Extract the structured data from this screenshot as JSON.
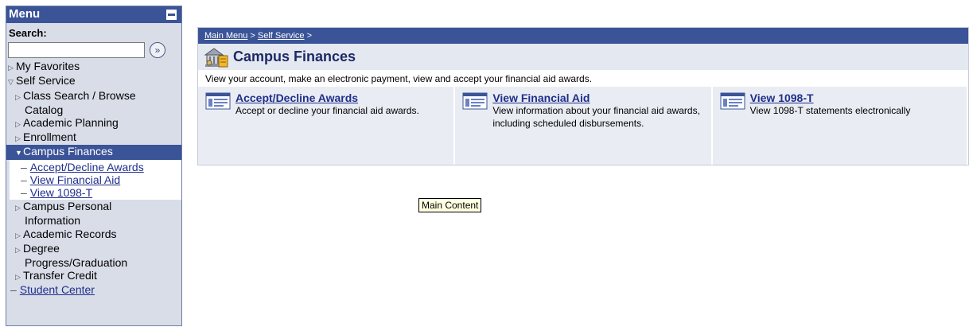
{
  "menu": {
    "title": "Menu",
    "search_label": "Search:",
    "search_value": "",
    "search_go_glyph": "»",
    "my_favorites": "My Favorites",
    "self_service": "Self Service",
    "items": {
      "class_search_line1": "Class Search / Browse",
      "class_search_line2": "Catalog",
      "academic_planning": "Academic Planning",
      "enrollment": "Enrollment",
      "campus_finances": "Campus Finances",
      "campus_finances_sub": [
        "Accept/Decline Awards",
        "View Financial Aid",
        "View 1098-T"
      ],
      "campus_personal_line1": "Campus Personal",
      "campus_personal_line2": "Information",
      "academic_records": "Academic Records",
      "degree_line1": "Degree",
      "degree_line2": "Progress/Graduation",
      "transfer_credit": "Transfer Credit",
      "student_center": "Student Center"
    }
  },
  "main": {
    "breadcrumb": [
      "Main Menu",
      "Self Service"
    ],
    "breadcrumb_sep": ">",
    "title": "Campus Finances",
    "description": "View your account, make an electronic payment, view and accept your financial aid awards.",
    "cards": [
      {
        "title": "Accept/Decline Awards",
        "desc": "Accept or decline your financial aid awards."
      },
      {
        "title": "View Financial Aid",
        "desc": "View information about your financial aid awards, including scheduled disbursements."
      },
      {
        "title": "View 1098-T",
        "desc": "View 1098-T statements electronically"
      }
    ]
  },
  "tooltip": "Main Content",
  "colors": {
    "menu_header": "#3b5498",
    "menu_bg": "#d9dde8",
    "link": "#1f2f8c",
    "title_bar": "#e4e8f0"
  }
}
